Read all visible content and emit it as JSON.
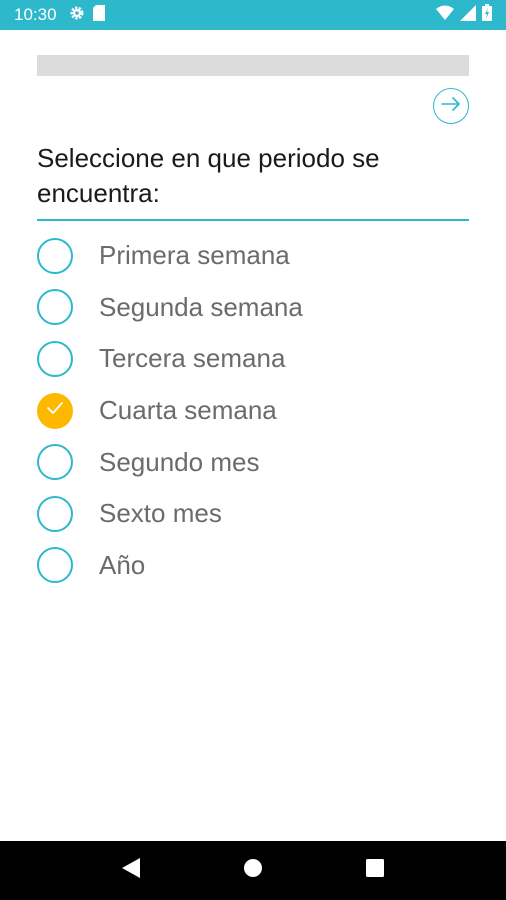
{
  "status_bar": {
    "time": "10:30",
    "left_icons": [
      "gear-icon",
      "sd-card-icon"
    ],
    "right_icons": [
      "wifi-icon",
      "signal-icon",
      "battery-icon"
    ]
  },
  "progress": {
    "fraction": 0.0
  },
  "next_button": {
    "icon": "arrow-right-icon"
  },
  "question": {
    "text": "Seleccione en que periodo se encuentra:"
  },
  "options": [
    {
      "label": "Primera semana",
      "selected": false
    },
    {
      "label": "Segunda semana",
      "selected": false
    },
    {
      "label": "Tercera semana",
      "selected": false
    },
    {
      "label": "Cuarta semana",
      "selected": true
    },
    {
      "label": "Segundo mes",
      "selected": false
    },
    {
      "label": "Sexto mes",
      "selected": false
    },
    {
      "label": "Año",
      "selected": false
    }
  ],
  "nav_bar": {
    "icons": [
      "back-icon",
      "home-icon",
      "recents-icon"
    ]
  },
  "colors": {
    "accent": "#2db8cc",
    "selected": "#ffb800",
    "progress_track": "#dcdcdc",
    "text_question": "#1a1a1a",
    "text_option": "#6b6b6b"
  }
}
